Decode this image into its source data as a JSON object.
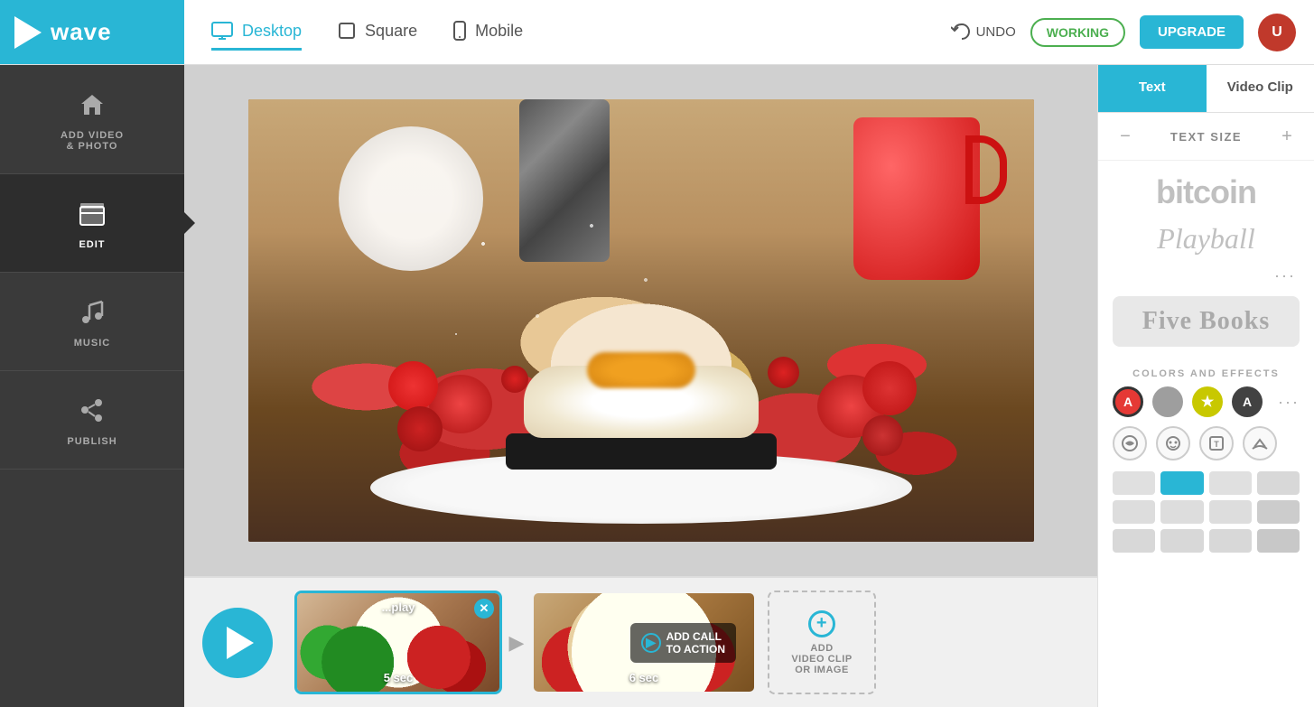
{
  "app": {
    "logo_text": "wave",
    "undo_label": "UNDO",
    "working_label": "WORKING",
    "upgrade_label": "UPGRADE"
  },
  "view_tabs": [
    {
      "id": "desktop",
      "label": "Desktop",
      "icon": "monitor",
      "active": true
    },
    {
      "id": "square",
      "label": "Square",
      "icon": "square",
      "active": false
    },
    {
      "id": "mobile",
      "label": "Mobile",
      "icon": "phone",
      "active": false
    }
  ],
  "sidebar": {
    "items": [
      {
        "id": "add",
        "label": "ADD VIDEO\n& PHOTO",
        "icon": "home",
        "active": false
      },
      {
        "id": "edit",
        "label": "EDIT",
        "icon": "clapperboard",
        "active": true
      },
      {
        "id": "music",
        "label": "MUSIC",
        "icon": "music",
        "active": false
      },
      {
        "id": "publish",
        "label": "PUBLISH",
        "icon": "share",
        "active": false
      }
    ]
  },
  "right_panel": {
    "tabs": [
      {
        "id": "text",
        "label": "Text",
        "active": true
      },
      {
        "id": "video_clip",
        "label": "Video Clip",
        "active": false
      }
    ],
    "text_size_label": "TEXT SIZE",
    "fonts": [
      {
        "name": "bitcoin",
        "display": "bitcoin",
        "style": "sans"
      },
      {
        "name": "playball",
        "display": "Playball",
        "style": "italic"
      },
      {
        "name": "five-books",
        "display": "Five Books",
        "style": "serif"
      }
    ],
    "colors_label": "COLORS AND EFFECTS",
    "colors": [
      {
        "value": "#e53935",
        "letter": "A",
        "selected": true
      },
      {
        "value": "#9e9e9e",
        "letter": "",
        "selected": false
      },
      {
        "value": "#c8c800",
        "letter": "★",
        "selected": false
      },
      {
        "value": "#424242",
        "letter": "A",
        "selected": false
      }
    ],
    "color_grid": [
      [
        "#e0e0e0",
        "#29b6d5",
        "#e0e0e0",
        "#e0e0e0"
      ],
      [
        "#e0e0e0",
        "#e0e0e0",
        "#e0e0e0",
        "#e0e0e0"
      ],
      [
        "#e0e0e0",
        "#e0e0e0",
        "#e0e0e0",
        "#e0e0e0"
      ]
    ]
  },
  "timeline": {
    "clips": [
      {
        "id": "clip1",
        "label": "...play",
        "duration": "5 sec",
        "active": true
      },
      {
        "id": "clip2",
        "label": "",
        "duration": "6 sec",
        "active": false,
        "has_cta": true,
        "cta_label": "ADD CALL\nTO ACTION"
      }
    ],
    "add_label": "ADD\nVIDEO CLIP\nOR IMAGE"
  }
}
